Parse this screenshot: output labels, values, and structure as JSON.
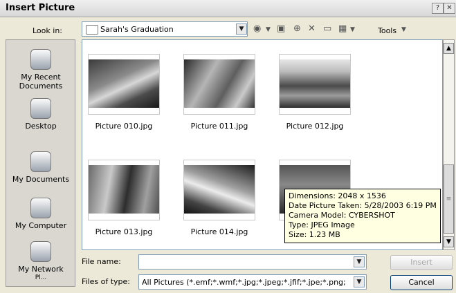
{
  "window": {
    "title": "Insert Picture",
    "help_label": "?",
    "close_label": "✕"
  },
  "toolbar": {
    "look_in_label": "Look in:",
    "look_in_value": "Sarah's Graduation",
    "tools_label": "Tools"
  },
  "places": [
    {
      "label_line1": "My Recent",
      "label_line2": "Documents"
    },
    {
      "label_line1": "Desktop",
      "label_line2": ""
    },
    {
      "label_line1": "My Documents",
      "label_line2": ""
    },
    {
      "label_line1": "My Computer",
      "label_line2": ""
    },
    {
      "label_line1": "My Network",
      "label_line2": "Pl..."
    }
  ],
  "files": [
    {
      "name": "Picture 010.jpg"
    },
    {
      "name": "Picture 011.jpg"
    },
    {
      "name": "Picture 012.jpg"
    },
    {
      "name": "Picture 013.jpg"
    },
    {
      "name": "Picture 014.jpg"
    },
    {
      "name": ""
    }
  ],
  "tooltip": {
    "dimensions": "Dimensions: 2048 x 1536",
    "date_taken": "Date Picture Taken: 5/28/2003 6:19 PM",
    "camera": "Camera Model: CYBERSHOT",
    "type": "Type: JPEG Image",
    "size": "Size: 1.23 MB"
  },
  "footer": {
    "file_name_label": "File name:",
    "file_name_value": "",
    "file_type_label": "Files of type:",
    "file_type_value": "All Pictures (*.emf;*.wmf;*.jpg;*.jpeg;*.jfif;*.jpe;*.png;",
    "insert_label": "Insert",
    "cancel_label": "Cancel"
  }
}
